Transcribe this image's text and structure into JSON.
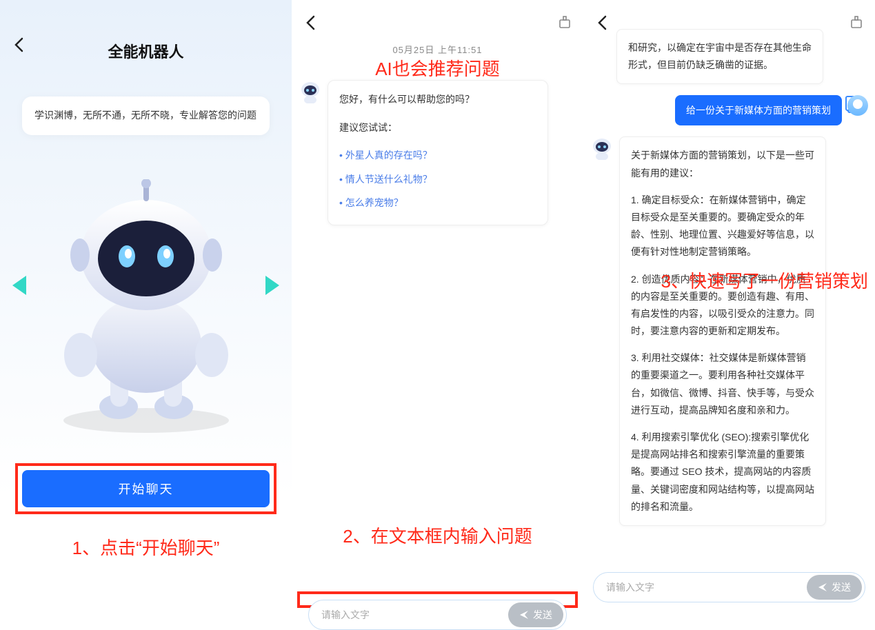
{
  "panel1": {
    "title": "全能机器人",
    "desc": "学识渊博，无所不通，无所不晓，专业解答您的问题",
    "start_button": "开始聊天",
    "annotation": "1、点击“开始聊天”"
  },
  "panel2": {
    "timestamp": "05月25日  上午11:51",
    "top_annotation": "AI也会推荐问题",
    "greeting": "您好，有什么可以帮助您的吗？",
    "try_label": "建议您试试：",
    "suggestions": [
      "外星人真的存在吗？",
      "情人节送什么礼物？",
      "怎么养宠物？"
    ],
    "bottom_annotation": "2、在文本框内输入问题",
    "input_placeholder": "请输入文字",
    "send_label": "发送"
  },
  "panel3": {
    "ai_prev_tail": "和研究，以确定在宇宙中是否存在其他生命形式，但目前仍缺乏确凿的证据。",
    "user_message": "给一份关于新媒体方面的营销策划",
    "ai_intro": "关于新媒体方面的营销策划，以下是一些可能有用的建议：",
    "ai_points": [
      "1. 确定目标受众：在新媒体营销中，确定目标受众是至关重要的。要确定受众的年龄、性别、地理位置、兴趣爱好等信息，以便有针对性地制定营销策略。",
      "2. 创造优质内容：在新媒体营销中，优质的内容是至关重要的。要创造有趣、有用、有启发性的内容，以吸引受众的注意力。同时，要注意内容的更新和定期发布。",
      "3. 利用社交媒体：社交媒体是新媒体营销的重要渠道之一。要利用各种社交媒体平台，如微信、微博、抖音、快手等，与受众进行互动，提高品牌知名度和亲和力。",
      "4. 利用搜索引擎优化 (SEO):搜索引擎优化是提高网站排名和搜索引擎流量的重要策略。要通过 SEO 技术，提高网站的内容质量、关键词密度和网站结构等，以提高网站的排名和流量。"
    ],
    "annotation": "3、快速写了一份营销策划",
    "input_placeholder": "请输入文字",
    "send_label": "发送"
  }
}
